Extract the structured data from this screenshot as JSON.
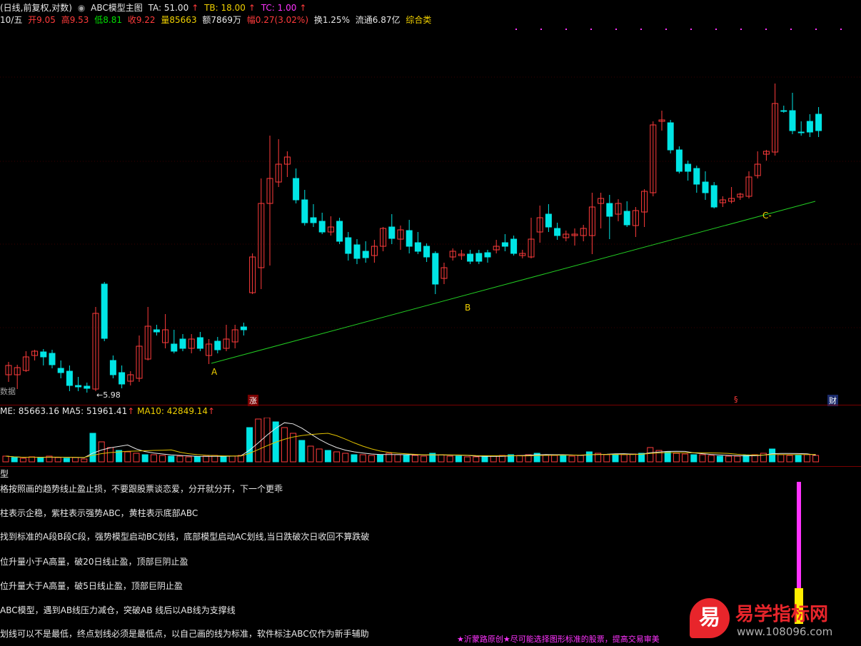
{
  "header": {
    "mode": "(日线,前复权,对数)",
    "indicator_name": "ABC模型主图",
    "ta": "TA: 51.00",
    "tb": "TB: 18.00",
    "tc": "TC: 1.00",
    "arrow": "↑"
  },
  "quote": {
    "date": "10/五",
    "open": "开9.05",
    "high": "高9.53",
    "low": "低8.81",
    "close": "收9.22",
    "volume": "量85663",
    "amount": "额7869万",
    "change": "幅0.27(3.02%)",
    "turnover": "换1.25%",
    "float": "流通6.87亿",
    "category": "综合类"
  },
  "chart_labels": {
    "point_a": "A",
    "point_b": "B",
    "point_c": "C-",
    "low_marker": "←5.98",
    "data_label": "数据",
    "badge_zhang": "涨",
    "badge_s": "§",
    "badge_cai": "财"
  },
  "volume": {
    "vol_label": "ME: 85663.16",
    "ma5_label": "MA5: 51961.41",
    "ma10_label": "MA10: 42849.14",
    "arrow": "↑"
  },
  "indicator_panel": {
    "title": "型",
    "lines": [
      "格按照画的趋势线止盈止损，不要跟股票谈恋爱，分开就分开，下一个更乖",
      "柱表示企稳，紫柱表示强势ABC，黄柱表示底部ABC",
      "找到标准的A段B段C段，强势模型启动BC划线，底部模型启动AC划线,当日跌破次日收回不算跌破",
      "位升量小于A高量，破20日线止盈，顶部巨阴止盈",
      "位升量大于A高量，破5日线止盈，顶部巨阴止盈",
      "ABC模型，遇到AB线压力减仓，突破AB 线后以AB线为支撑线",
      "划线可以不是最低，终点划线必须是最低点，以自己画的线为标准，软件标注ABC仅作为新手辅助"
    ],
    "footer": "★沂蒙路原创★尽可能选择图形标准的股票，提高交易审美"
  },
  "watermark": {
    "glyph": "易",
    "title": "易学指标网",
    "url": "www.108096.com"
  },
  "colors": {
    "up": "#ff3b3b",
    "down": "#00e5e5",
    "trendline": "#22cc22",
    "ma5": "#e8e8e8",
    "ma10": "#e0c000",
    "magenta": "#ff33ff",
    "yellow": "#ffee00"
  }
}
